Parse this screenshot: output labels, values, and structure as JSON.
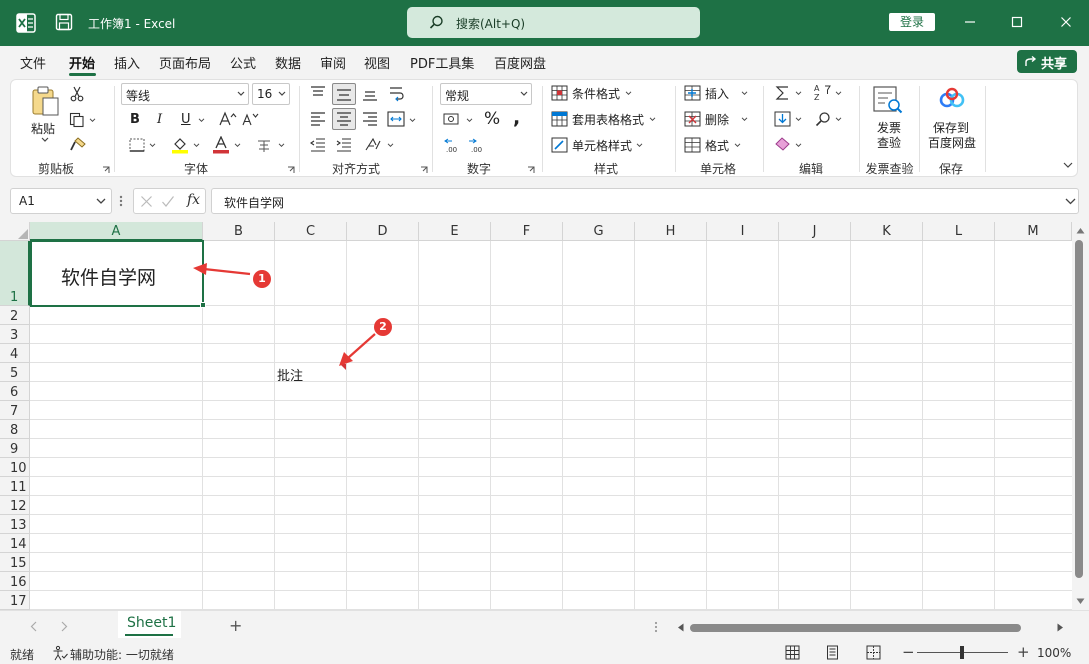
{
  "titlebar": {
    "title": "工作簿1  -  Excel",
    "search": "搜索(Alt+Q)",
    "login": "登录"
  },
  "menu": {
    "items": [
      "文件",
      "开始",
      "插入",
      "页面布局",
      "公式",
      "数据",
      "审阅",
      "视图",
      "PDF工具集",
      "百度网盘"
    ],
    "active": "开始",
    "share": "共享"
  },
  "ribbon": {
    "clipboard": {
      "paste": "粘贴",
      "label": "剪贴板"
    },
    "font": {
      "name": "等线",
      "size": "16",
      "bold": "B",
      "italic": "I",
      "underline": "U",
      "label": "字体"
    },
    "align": {
      "label": "对齐方式"
    },
    "number": {
      "format": "常规",
      "label": "数字"
    },
    "styles": {
      "cond": "条件格式",
      "table": "套用表格格式",
      "cell": "单元格样式",
      "label": "样式"
    },
    "cells": {
      "insert": "插入",
      "delete": "删除",
      "format": "格式",
      "label": "单元格"
    },
    "edit": {
      "label": "编辑"
    },
    "invoice": {
      "line1": "发票",
      "line2": "查验",
      "label": "发票查验"
    },
    "save": {
      "line1": "保存到",
      "line2": "百度网盘",
      "label": "保存"
    }
  },
  "formula_bar": {
    "cell_ref": "A1",
    "fx": "fx",
    "content": "软件自学网"
  },
  "grid": {
    "columns": [
      "A",
      "B",
      "C",
      "D",
      "E",
      "F",
      "G",
      "H",
      "I",
      "J",
      "K",
      "L",
      "M"
    ],
    "rows": [
      "1",
      "2",
      "3",
      "4",
      "5",
      "6",
      "7",
      "8",
      "9",
      "10",
      "11",
      "12",
      "13",
      "14",
      "15",
      "16",
      "17"
    ],
    "selected_cell": "A1",
    "a1_text": "软件自学网",
    "c5_text": "批注",
    "annotation_1": "1",
    "annotation_2": "2"
  },
  "sheets": {
    "active": "Sheet1",
    "add": "+"
  },
  "status": {
    "ready": "就绪",
    "accessibility": "辅助功能: 一切就绪",
    "zoom": "100%"
  },
  "colors": {
    "brand": "#1e7145",
    "annotation": "#e53935",
    "comment_marker": "#d13438"
  }
}
